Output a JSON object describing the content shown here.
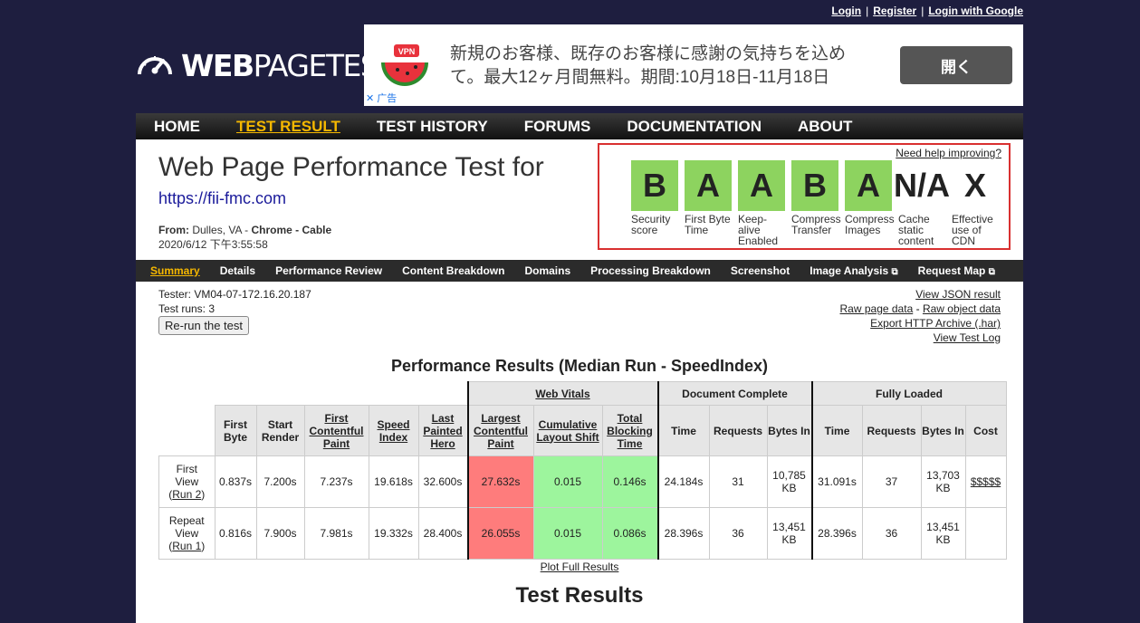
{
  "toplinks": {
    "login": "Login",
    "register": "Register",
    "google": "Login with Google",
    "sep": "|"
  },
  "logo": {
    "text_bold": "WEB",
    "text_rest": "PAGETEST"
  },
  "ad": {
    "text": "新規のお客様、既存のお客様に感謝の気持ちを込めて。最大12ヶ月間無料。期間:10月18日-11月18日",
    "button": "開く",
    "tag": "✕ 广告",
    "badge": "VPN"
  },
  "nav": [
    {
      "label": "HOME",
      "active": false
    },
    {
      "label": "TEST RESULT",
      "active": true
    },
    {
      "label": "TEST HISTORY",
      "active": false
    },
    {
      "label": "FORUMS",
      "active": false
    },
    {
      "label": "DOCUMENTATION",
      "active": false
    },
    {
      "label": "ABOUT",
      "active": false
    }
  ],
  "header": {
    "title": "Web Page Performance Test for",
    "url": "https://fii-fmc.com",
    "from_label": "From:",
    "from_value": "Dulles, VA - ",
    "browser": "Chrome - Cable",
    "timestamp": "2020/6/12 下午3:55:58"
  },
  "grades": {
    "need_help": "Need help improving?",
    "items": [
      {
        "grade": "B",
        "label": "Security score",
        "green": true
      },
      {
        "grade": "A",
        "label": "First Byte Time",
        "green": true
      },
      {
        "grade": "A",
        "label": "Keep-alive Enabled",
        "green": true
      },
      {
        "grade": "B",
        "label": "Compress Transfer",
        "green": true
      },
      {
        "grade": "A",
        "label": "Compress Images",
        "green": true
      },
      {
        "grade": "N/A",
        "label": "Cache static content",
        "green": false
      },
      {
        "grade": "X",
        "label": "Effective use of CDN",
        "green": false
      }
    ]
  },
  "subnav": [
    {
      "label": "Summary",
      "active": true,
      "ext": false
    },
    {
      "label": "Details",
      "active": false,
      "ext": false
    },
    {
      "label": "Performance Review",
      "active": false,
      "ext": false
    },
    {
      "label": "Content Breakdown",
      "active": false,
      "ext": false
    },
    {
      "label": "Domains",
      "active": false,
      "ext": false
    },
    {
      "label": "Processing Breakdown",
      "active": false,
      "ext": false
    },
    {
      "label": "Screenshot",
      "active": false,
      "ext": false
    },
    {
      "label": "Image Analysis",
      "active": false,
      "ext": true
    },
    {
      "label": "Request Map",
      "active": false,
      "ext": true
    }
  ],
  "test_info": {
    "tester": "Tester: VM04-07-172.16.20.187",
    "runs": "Test runs: 3",
    "rerun": "Re-run the test"
  },
  "raw_links": [
    "View JSON result",
    "Raw page data",
    "Raw object data",
    "Export HTTP Archive (.har)",
    "View Test Log"
  ],
  "raw_sep": "-",
  "perf_title": "Performance Results (Median Run - SpeedIndex)",
  "table": {
    "group_headers": {
      "web_vitals": "Web Vitals",
      "doc_complete": "Document Complete",
      "fully_loaded": "Fully Loaded"
    },
    "columns": [
      "First Byte",
      "Start Render",
      "First Contentful Paint",
      "Speed Index",
      "Last Painted Hero",
      "Largest Contentful Paint",
      "Cumulative Layout Shift",
      "Total Blocking Time",
      "Time",
      "Requests",
      "Bytes In",
      "Time",
      "Requests",
      "Bytes In",
      "Cost"
    ],
    "rows": [
      {
        "label1": "First",
        "label2": "View",
        "run": "Run 2",
        "values": [
          "0.837s",
          "7.200s",
          "7.237s",
          "19.618s",
          "32.600s",
          "27.632s",
          "0.015",
          "0.146s",
          "24.184s",
          "31",
          "10,785 KB",
          "31.091s",
          "37",
          "13,703 KB",
          "$$$$$"
        ]
      },
      {
        "label1": "Repeat",
        "label2": "View",
        "run": "Run 1",
        "values": [
          "0.816s",
          "7.900s",
          "7.981s",
          "19.332s",
          "28.400s",
          "26.055s",
          "0.015",
          "0.086s",
          "28.396s",
          "36",
          "13,451 KB",
          "28.396s",
          "36",
          "13,451 KB",
          ""
        ]
      }
    ]
  },
  "plot_link": "Plot Full Results",
  "test_results_heading": "Test Results",
  "colors": {
    "accent": "#f6b800",
    "grade_green": "#8dd35f",
    "red_cell": "#fe7c7c",
    "green_cell": "#9df59d",
    "page_bg": "#1e1e3f"
  }
}
